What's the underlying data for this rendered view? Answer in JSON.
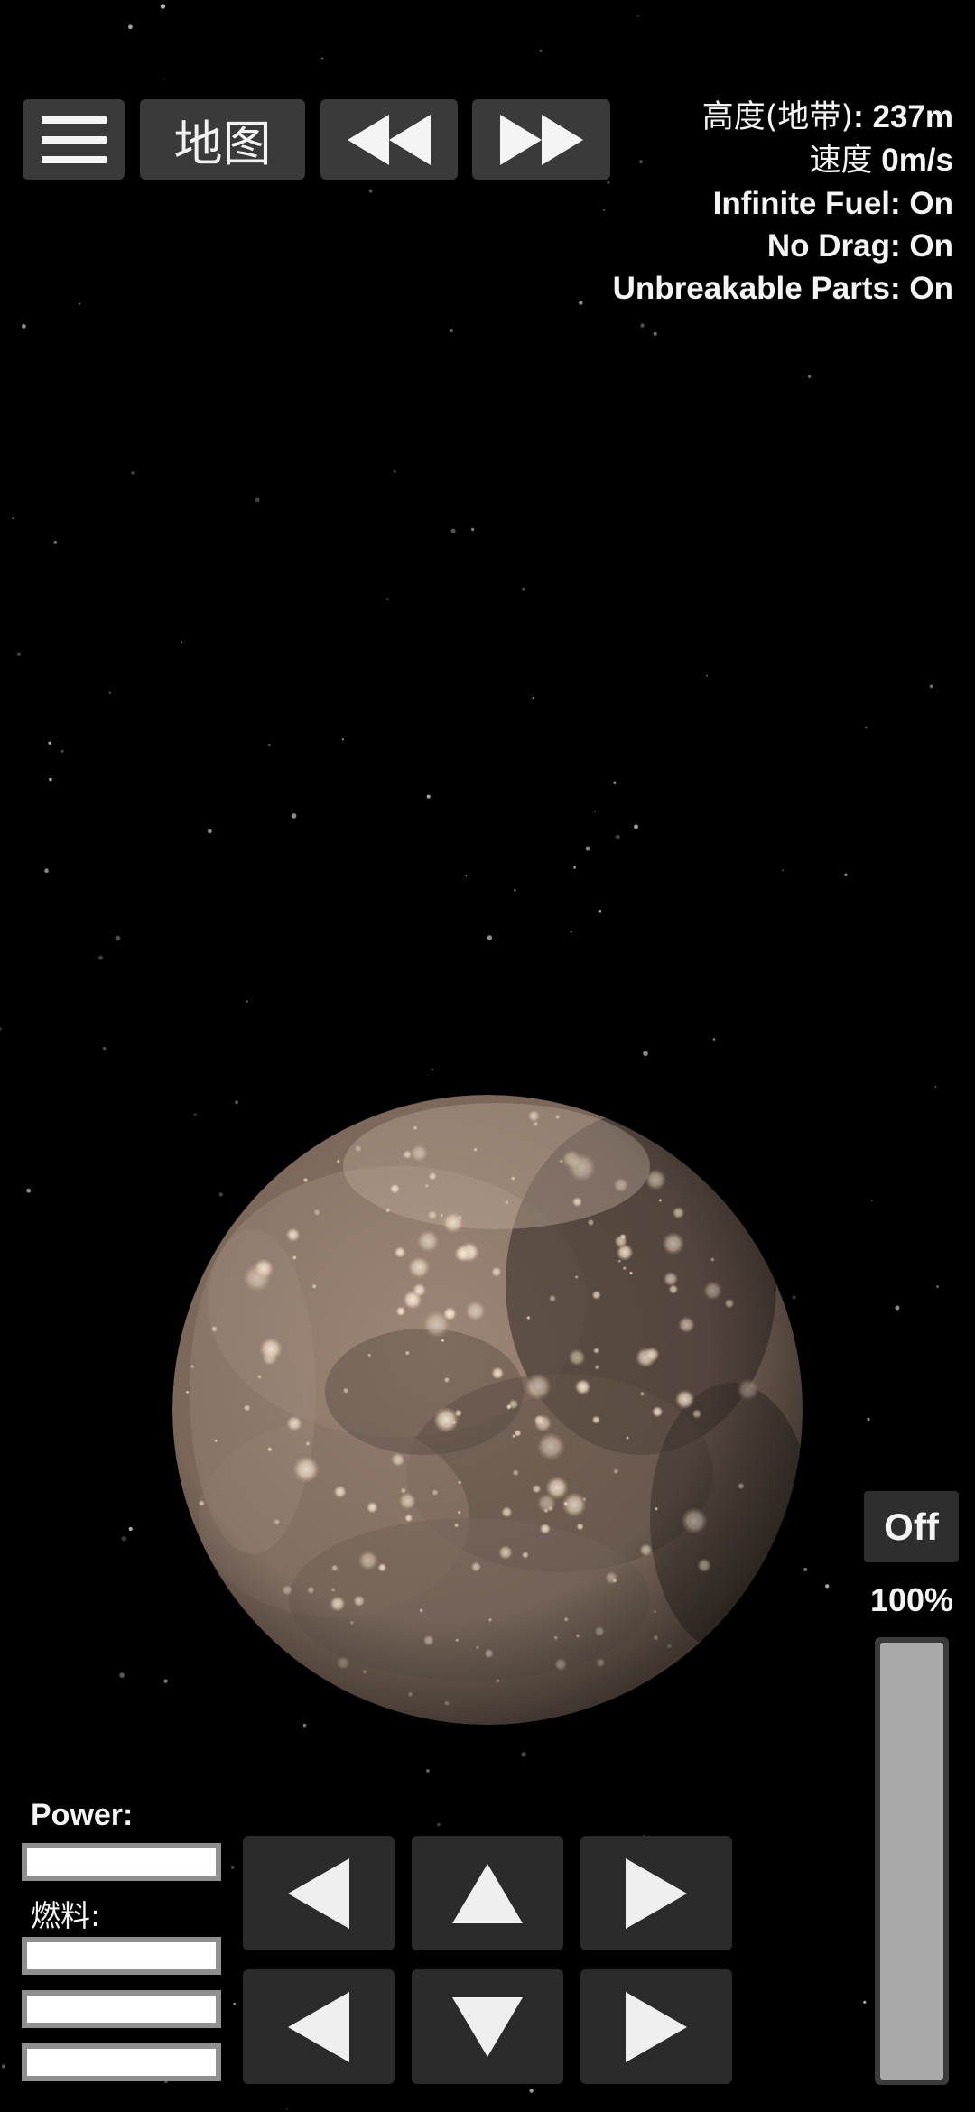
{
  "toolbar": {
    "menu_icon": "hamburger-menu-icon",
    "map_label": "地图",
    "rewind_icon": "rewind-icon",
    "fast_forward_icon": "fast-forward-icon"
  },
  "telemetry": {
    "altitude_label": "高度(地带)",
    "altitude_value": ": 237m",
    "speed_label": "速度",
    "speed_value": " 0m/s",
    "infinite_fuel": "Infinite Fuel: On",
    "no_drag": "No Drag: On",
    "unbreakable_parts": "Unbreakable Parts: On"
  },
  "throttle": {
    "toggle_label": "Off",
    "percent_label": "100%",
    "level": 1.0
  },
  "status": {
    "power_label": "Power:",
    "power_level": 1.0,
    "fuel_label": "燃料:",
    "fuel_levels": [
      1.0,
      1.0,
      1.0
    ]
  },
  "controls": {
    "row1": [
      "rotate-left-icon",
      "thrust-up-icon",
      "rotate-right-icon"
    ],
    "row2": [
      "move-left-icon",
      "thrust-down-icon",
      "move-right-icon"
    ]
  },
  "colors": {
    "background": "#000000",
    "button": "#3a3a3a",
    "pad_button": "#2b2b2b",
    "text": "#f4f4f4",
    "planet_base": "#8a7364",
    "crater": "#f3e0cc"
  }
}
